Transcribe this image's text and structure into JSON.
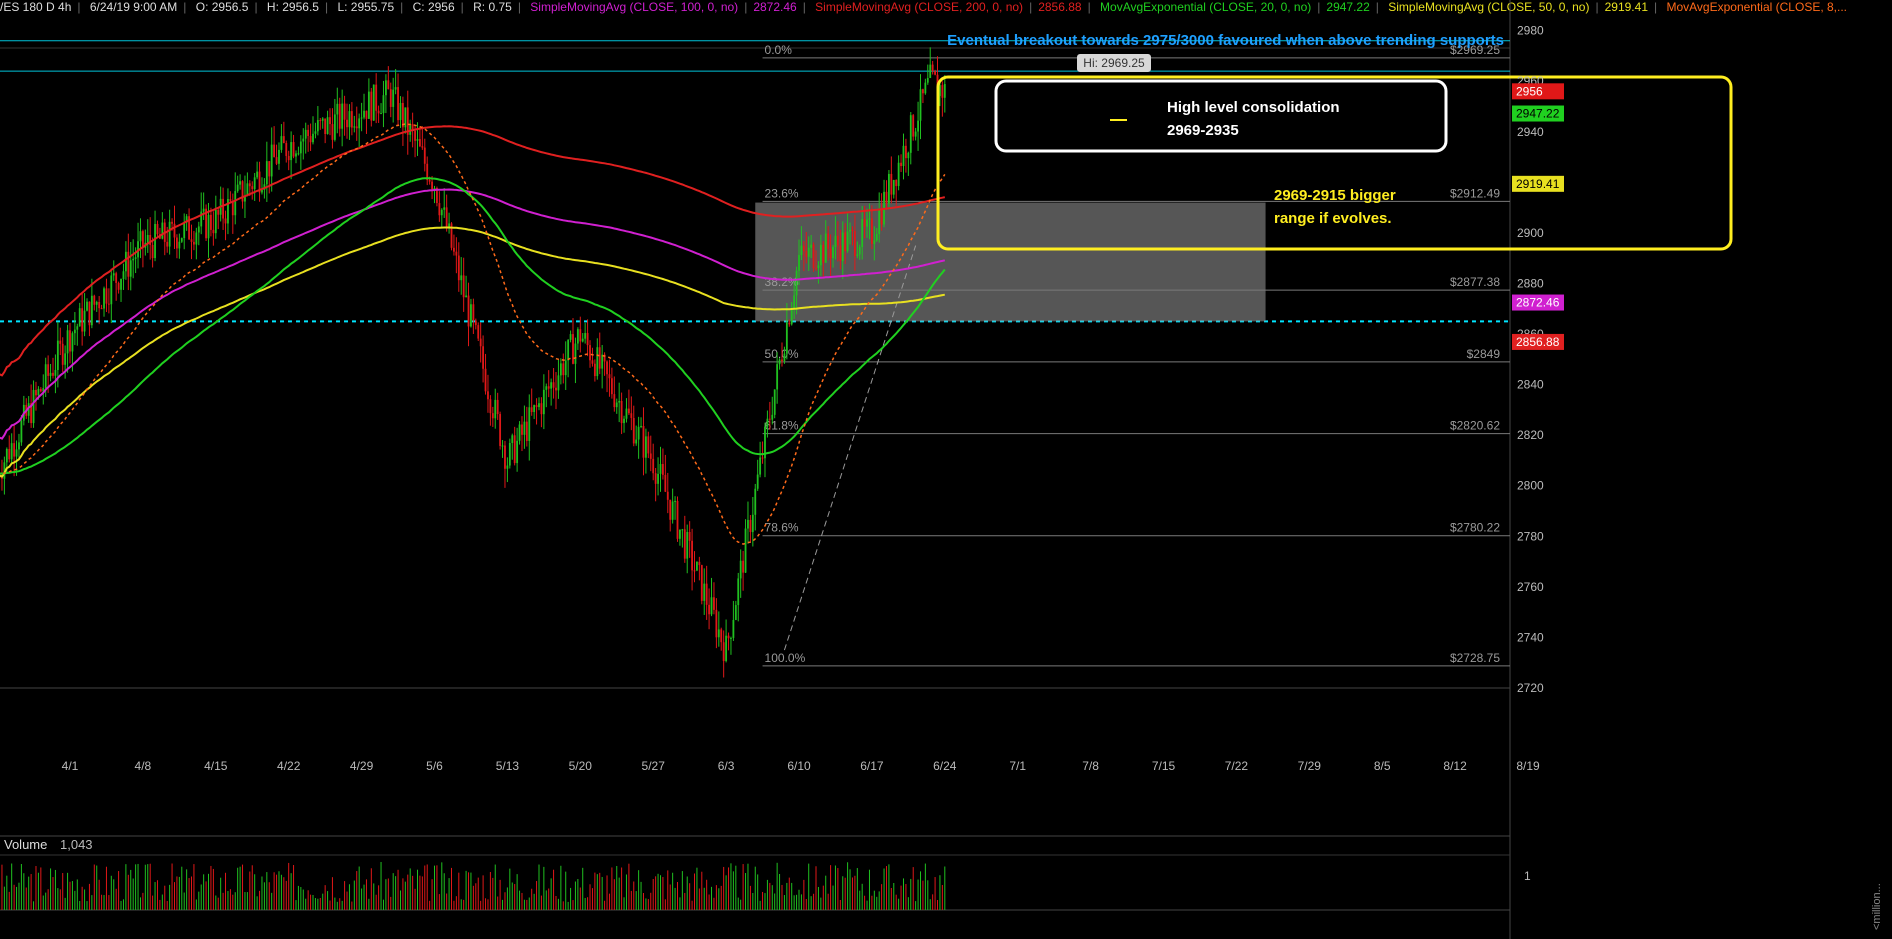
{
  "header": {
    "symbol": "/ES 180 D 4h",
    "datetime": "6/24/19 9:00 AM",
    "ohlc": [
      "O: 2956.5",
      "H: 2956.5",
      "L: 2955.75",
      "C: 2956",
      "R: 0.75"
    ],
    "studies": [
      {
        "label": "SimpleMovingAvg (CLOSE, 100, 0, no)",
        "value": "2872.46",
        "color": "#d020d0"
      },
      {
        "label": "SimpleMovingAvg (CLOSE, 200, 0, no)",
        "value": "2856.88",
        "color": "#e02020"
      },
      {
        "label": "MovAvgExponential (CLOSE, 20, 0, no)",
        "value": "2947.22",
        "color": "#20d020"
      },
      {
        "label": "SimpleMovingAvg (CLOSE, 50, 0, no)",
        "value": "2919.41",
        "color": "#e8e020"
      },
      {
        "label": "MovAvgExponential (CLOSE, 8,...",
        "value": "",
        "color": "#ff6a1a"
      }
    ]
  },
  "annotations": {
    "headline": "Eventual breakout towards 2975/3000 favoured when above trending supports",
    "box1_line1": "High level consolidation",
    "box1_line2": "2969-2935",
    "box2_line1": "2969-2915 bigger",
    "box2_line2": "range if evolves.",
    "hi_label": "Hi: 2969.25"
  },
  "volume": {
    "label": "Volume",
    "value": "1,043",
    "axis_tick": "1",
    "axis_unit": "<million..."
  },
  "colors": {
    "up": "#20c020",
    "down": "#e01818",
    "ema8": "#ff6a1a",
    "ema20": "#20d020",
    "sma50": "#e8e020",
    "sma100": "#d020d0",
    "sma200": "#e02020",
    "support": "#00e5ff",
    "headline": "#1ea0ff",
    "annot": "#ffee20"
  },
  "chart_data": {
    "type": "candlestick",
    "x_axis": {
      "ticks": [
        "4/1",
        "4/8",
        "4/15",
        "4/22",
        "4/29",
        "5/6",
        "5/13",
        "5/20",
        "5/27",
        "6/3",
        "6/10",
        "6/17",
        "6/24",
        "7/1",
        "7/8",
        "7/15",
        "7/22",
        "7/29",
        "8/5",
        "8/12",
        "8/19"
      ]
    },
    "y_axis": {
      "range": [
        2720,
        2985
      ],
      "ticks": [
        2720,
        2740,
        2760,
        2780,
        2800,
        2820,
        2840,
        2860,
        2880,
        2900,
        2920,
        2940,
        2960,
        2980
      ]
    },
    "price_tags": [
      {
        "value": 2956,
        "label": "2956",
        "color": "#e01818"
      },
      {
        "value": 2947.22,
        "label": "2947.22",
        "color": "#20d020"
      },
      {
        "value": 2919.41,
        "label": "2919.41",
        "color": "#e8e020"
      },
      {
        "value": 2872.46,
        "label": "2872.46",
        "color": "#d020d0"
      },
      {
        "value": 2856.88,
        "label": "2856.88",
        "color": "#e02020"
      }
    ],
    "fibonacci": [
      {
        "pct": "0.0%",
        "price": "$2969.25",
        "value": 2969.25
      },
      {
        "pct": "23.6%",
        "price": "$2912.49",
        "value": 2912.49
      },
      {
        "pct": "38.2%",
        "price": "$2877.38",
        "value": 2877.38
      },
      {
        "pct": "50.0%",
        "price": "$2849",
        "value": 2849
      },
      {
        "pct": "61.8%",
        "price": "$2820.62",
        "value": 2820.62
      },
      {
        "pct": "78.6%",
        "price": "$2780.22",
        "value": 2780.22
      },
      {
        "pct": "100.0%",
        "price": "$2728.75",
        "value": 2728.75
      }
    ],
    "support_lines": [
      2976,
      2964
    ],
    "support_dashed": 2865,
    "grey_zone": {
      "from_date_index": 47,
      "to_date_index": 82,
      "low": 2865,
      "high": 2912
    },
    "key_prices": [
      {
        "date": "3/25",
        "close": 2805
      },
      {
        "date": "4/1",
        "close": 2860
      },
      {
        "date": "4/8",
        "close": 2895
      },
      {
        "date": "4/15",
        "close": 2905
      },
      {
        "date": "4/22",
        "close": 2935
      },
      {
        "date": "5/1",
        "close": 2955
      },
      {
        "date": "5/6",
        "close": 2920
      },
      {
        "date": "5/13",
        "close": 2810
      },
      {
        "date": "5/20",
        "close": 2860
      },
      {
        "date": "5/27",
        "close": 2810
      },
      {
        "date": "6/3",
        "close": 2735
      },
      {
        "date": "6/10",
        "close": 2890
      },
      {
        "date": "6/17",
        "close": 2900
      },
      {
        "date": "6/21",
        "close": 2960
      },
      {
        "date": "6/24",
        "close": 2956
      }
    ]
  }
}
